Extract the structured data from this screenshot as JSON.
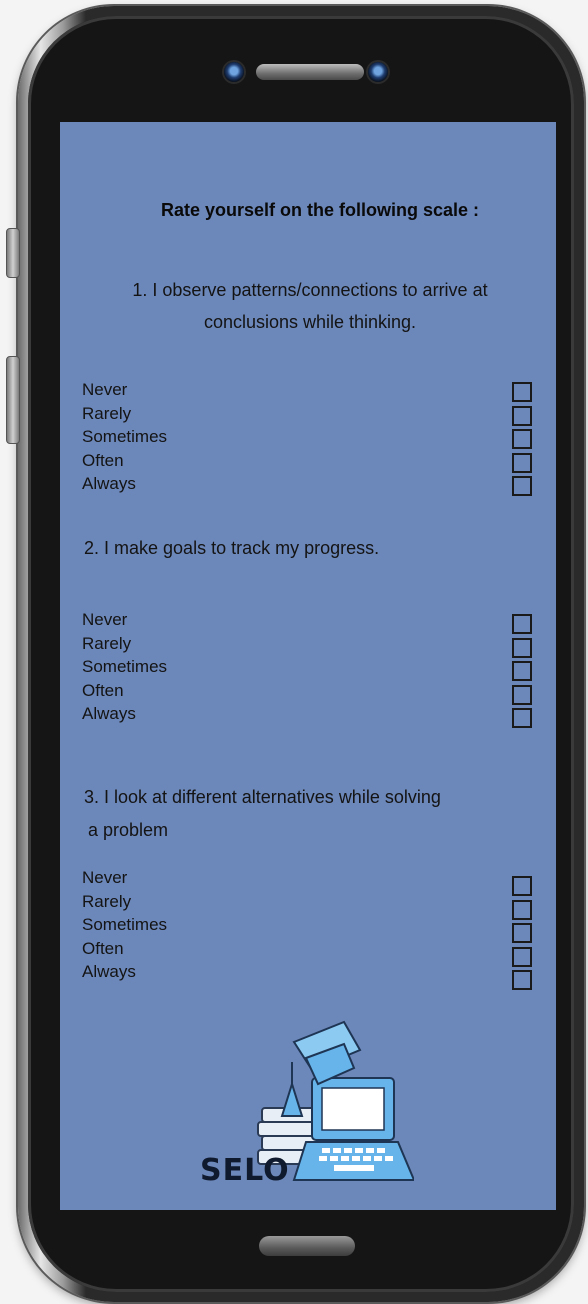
{
  "survey": {
    "heading": "Rate yourself on the following scale :",
    "questions": [
      {
        "line1": "1. I observe patterns/connections to arrive at",
        "line2": "conclusions while thinking.",
        "options": [
          "Never",
          "Rarely",
          "Sometimes",
          "Often",
          "Always"
        ]
      },
      {
        "line1": "2. I make goals to track my progress.",
        "options": [
          "Never",
          "Rarely",
          "Sometimes",
          "Often",
          "Always"
        ]
      },
      {
        "line1": "3. I look at different alternatives while solving",
        "line2": "a problem",
        "options": [
          "Never",
          "Rarely",
          "Sometimes",
          "Often",
          "Always"
        ]
      }
    ]
  },
  "logo": {
    "text": "SELO",
    "icon": "laptop-books-graduation-cap-icon"
  },
  "colors": {
    "screen_bg": "#6c87b9",
    "logo_blue": "#66b4ea",
    "text": "#141414"
  }
}
